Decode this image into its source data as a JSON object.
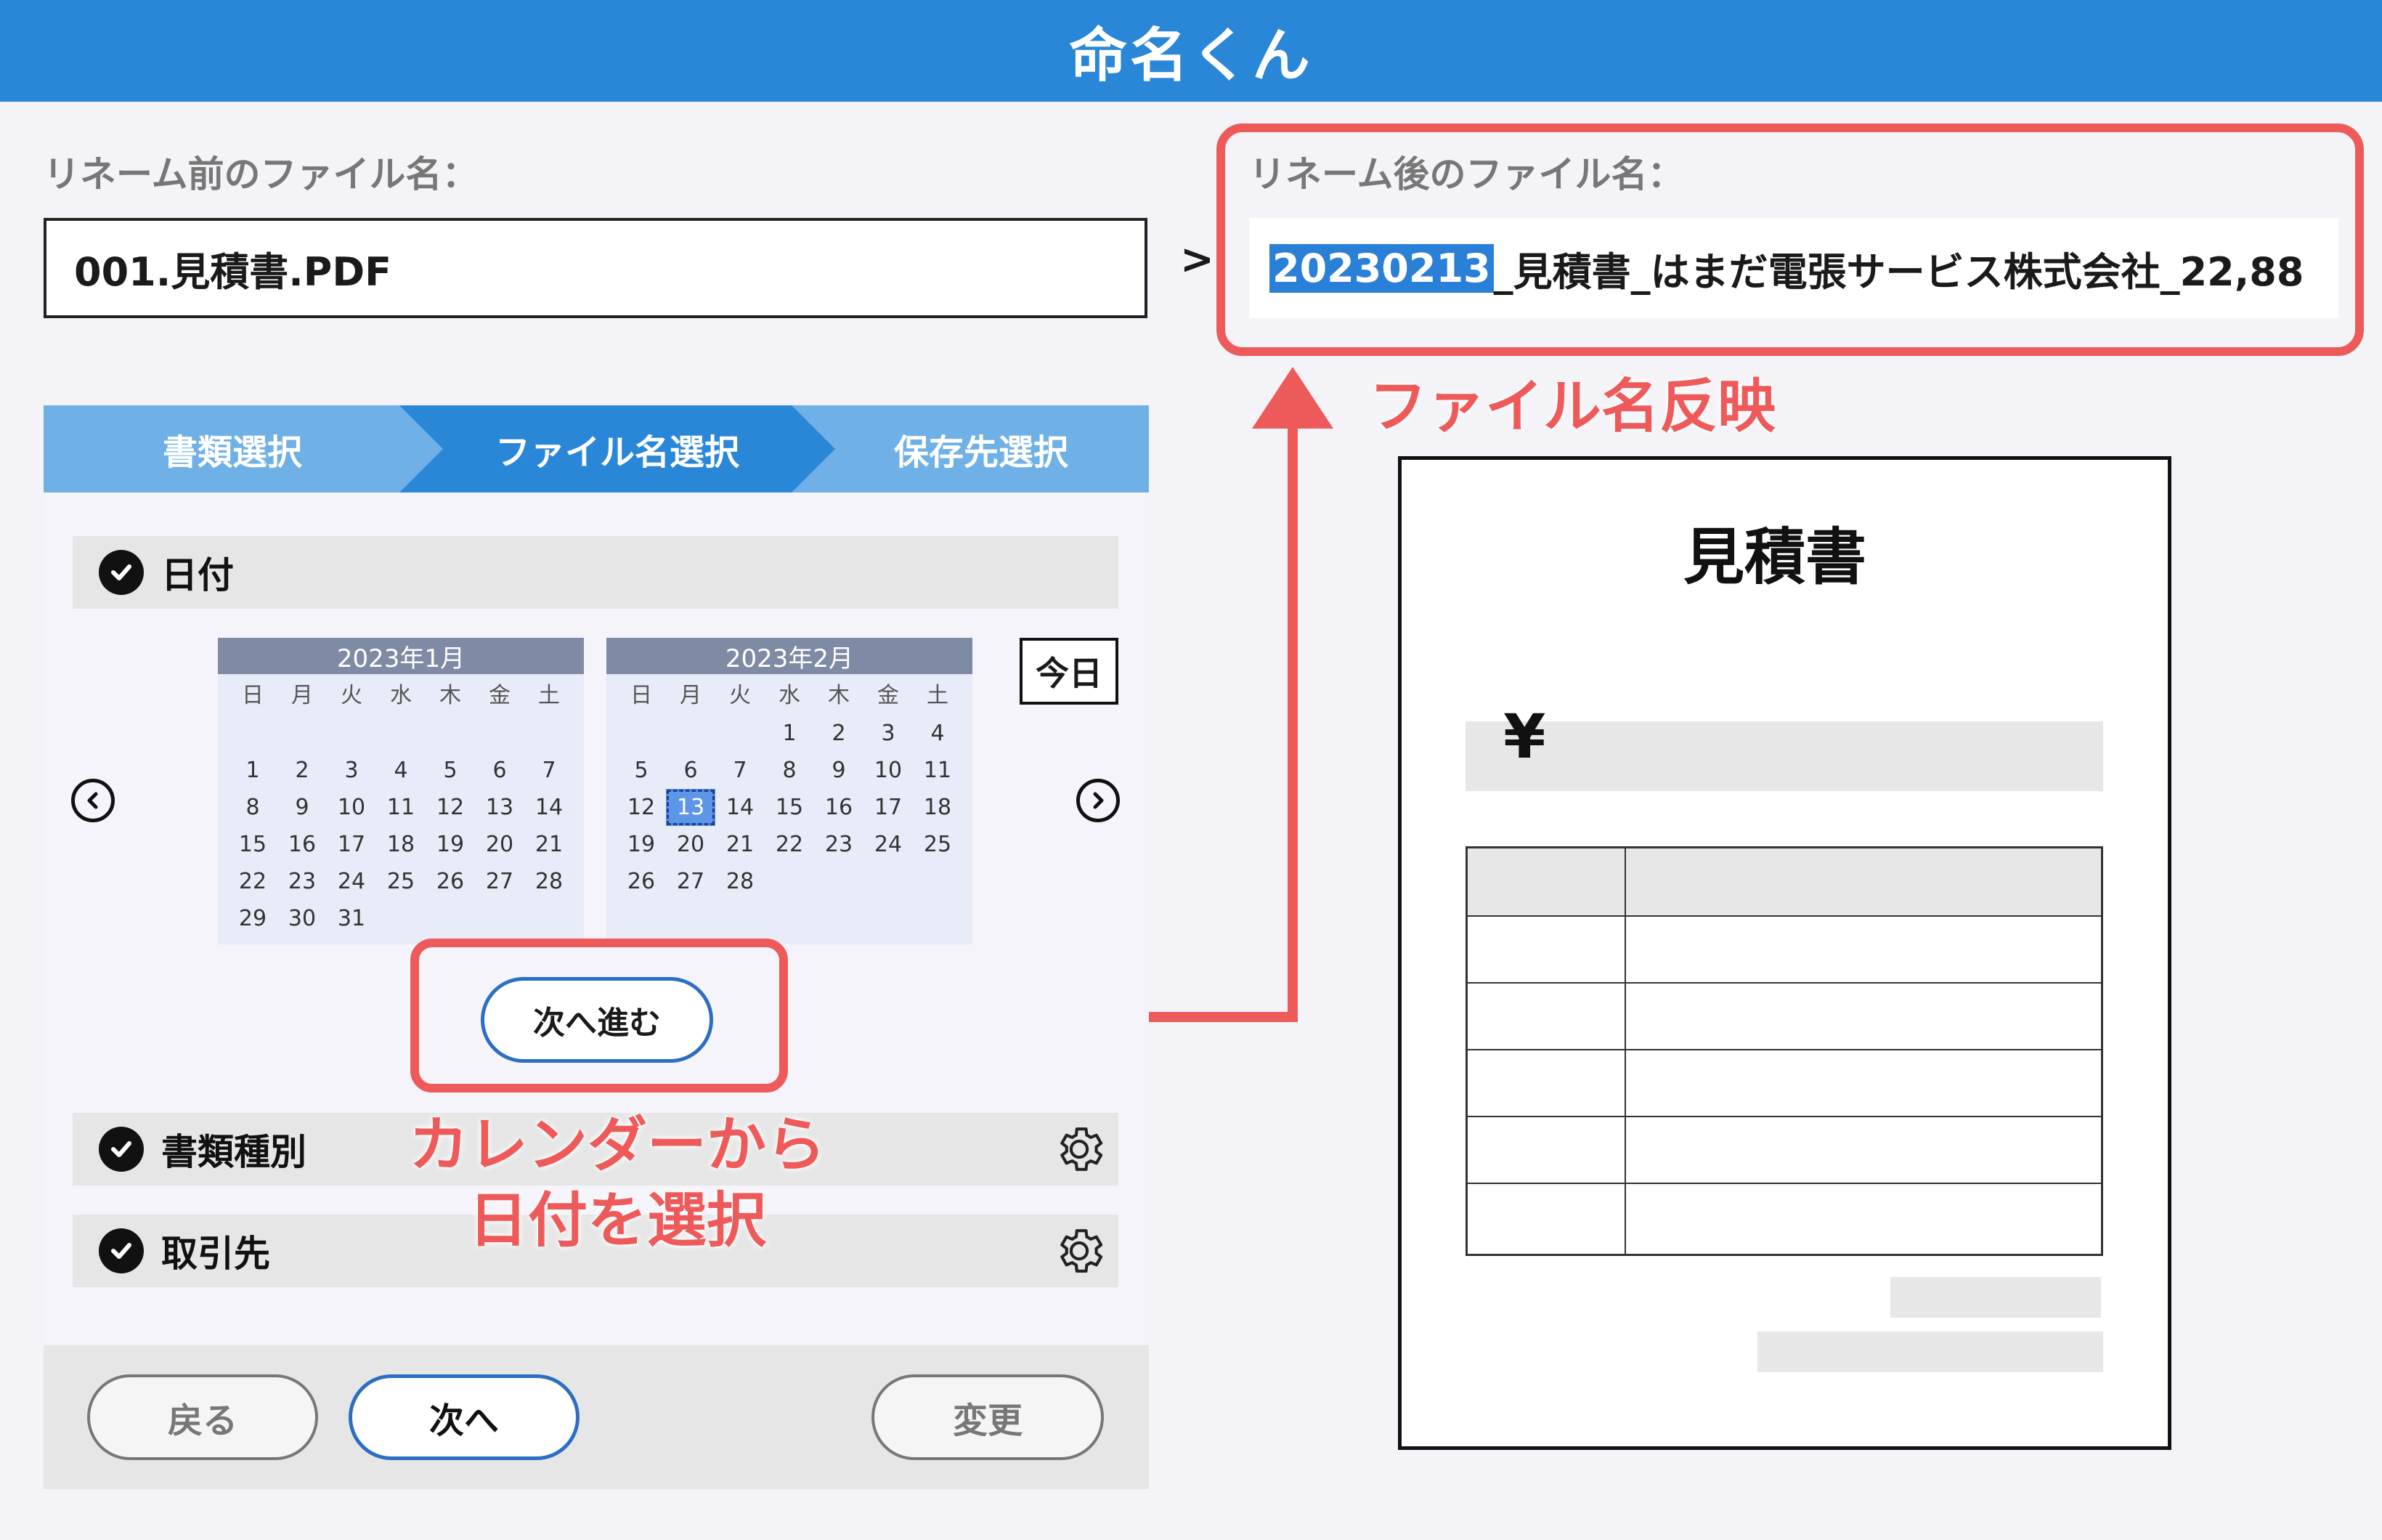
{
  "app": {
    "title": "命名くん"
  },
  "before": {
    "label": "リネーム前のファイル名：",
    "value": "001.見積書.PDF"
  },
  "arrow": ">",
  "after": {
    "label": "リネーム後のファイル名：",
    "highlight": "20230213",
    "rest": "_見積書_はまだ電張サービス株式会社_22,88"
  },
  "annotations": {
    "reflect": "ファイル名反映",
    "calendar_line1": "カレンダーから",
    "calendar_line2": "日付を選択"
  },
  "steps": [
    {
      "label": "書類選択"
    },
    {
      "label": "ファイル名選択"
    },
    {
      "label": "保存先選択"
    }
  ],
  "sections": {
    "date": "日付",
    "doc_type": "書類種別",
    "partner": "取引先"
  },
  "calendar": {
    "weekdays": [
      "日",
      "月",
      "火",
      "水",
      "木",
      "金",
      "土"
    ],
    "months": [
      {
        "title": "2023年1月",
        "rows": [
          [
            "",
            "",
            "",
            "",
            "",
            "",
            ""
          ],
          [
            "1",
            "2",
            "3",
            "4",
            "5",
            "6",
            "7"
          ],
          [
            "8",
            "9",
            "10",
            "11",
            "12",
            "13",
            "14"
          ],
          [
            "15",
            "16",
            "17",
            "18",
            "19",
            "20",
            "21"
          ],
          [
            "22",
            "23",
            "24",
            "25",
            "26",
            "27",
            "28"
          ],
          [
            "29",
            "30",
            "31",
            "",
            "",
            "",
            ""
          ]
        ]
      },
      {
        "title": "2023年2月",
        "rows": [
          [
            "",
            "",
            "",
            "1",
            "2",
            "3",
            "4"
          ],
          [
            "5",
            "6",
            "7",
            "8",
            "9",
            "10",
            "11"
          ],
          [
            "12",
            "13",
            "14",
            "15",
            "16",
            "17",
            "18"
          ],
          [
            "19",
            "20",
            "21",
            "22",
            "23",
            "24",
            "25"
          ],
          [
            "26",
            "27",
            "28",
            "",
            "",
            "",
            ""
          ],
          [
            "",
            "",
            "",
            "",
            "",
            "",
            ""
          ]
        ],
        "selected": "13"
      }
    ],
    "today_label": "今日"
  },
  "buttons": {
    "next_step": "次へ進む",
    "back": "戻る",
    "next": "次へ",
    "change": "変更"
  },
  "document": {
    "title": "見積書",
    "currency": "¥"
  },
  "colors": {
    "header_blue": "#2a87d8",
    "accent_red": "#ee5a5a",
    "step_light": "#6fb0e6",
    "step_active": "#2a87d8",
    "selection_blue": "#2a7fd6"
  },
  "icons": [
    "check-icon",
    "chevron-left-icon",
    "chevron-right-icon",
    "gear-icon",
    "arrow-up-icon"
  ]
}
